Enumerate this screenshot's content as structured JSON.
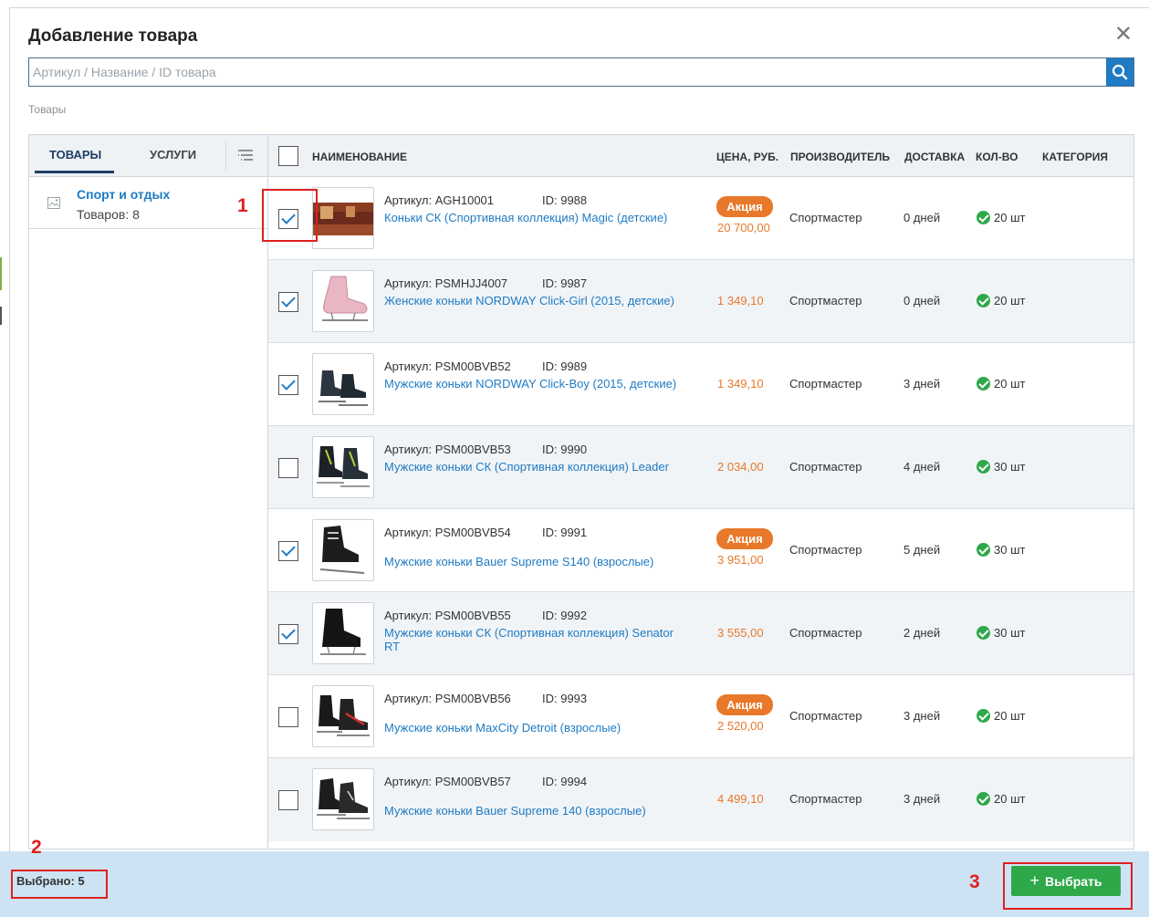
{
  "dialog": {
    "title": "Добавление товара",
    "close_glyph": "✕"
  },
  "search": {
    "placeholder": "Артикул / Название / ID товара",
    "value": ""
  },
  "breadcrumb": "Товары",
  "sidebar": {
    "tabs": [
      {
        "label": "ТОВАРЫ",
        "active": true
      },
      {
        "label": "УСЛУГИ",
        "active": false
      }
    ],
    "categories": [
      {
        "name": "Спорт и отдых",
        "count": "Товаров: 8"
      }
    ]
  },
  "table": {
    "headers": {
      "name": "НАИМЕНОВАНИЕ",
      "price": "ЦЕНА, РУБ.",
      "maker": "ПРОИЗВОДИТЕЛЬ",
      "delivery": "ДОСТАВКА",
      "qty": "КОЛ-ВО",
      "category": "КАТЕГОРИЯ"
    },
    "rows": [
      {
        "checked": true,
        "article": "Артикул: AGH10001",
        "id": "ID: 9988",
        "name": "Коньки СК (Спортивная коллекция) Magic (детские)",
        "promo": "Акция",
        "price": "20 700,00",
        "maker": "Спортмастер",
        "delivery": "0 дней",
        "qty": "20 шт"
      },
      {
        "checked": true,
        "article": "Артикул: PSMHJJ4007",
        "id": "ID: 9987",
        "name": "Женские коньки NORDWAY Click-Girl (2015, детские)",
        "promo": "",
        "price": "1 349,10",
        "maker": "Спортмастер",
        "delivery": "0 дней",
        "qty": "20 шт"
      },
      {
        "checked": true,
        "article": "Артикул: PSM00BVB52",
        "id": "ID: 9989",
        "name": "Мужские коньки NORDWAY Click-Boy (2015, детские)",
        "promo": "",
        "price": "1 349,10",
        "maker": "Спортмастер",
        "delivery": "3 дней",
        "qty": "20 шт"
      },
      {
        "checked": false,
        "article": "Артикул: PSM00BVB53",
        "id": "ID: 9990",
        "name": "Мужские коньки СК (Спортивная коллекция) Leader",
        "promo": "",
        "price": "2 034,00",
        "maker": "Спортмастер",
        "delivery": "4 дней",
        "qty": "30 шт"
      },
      {
        "checked": true,
        "article": "Артикул: PSM00BVB54",
        "id": "ID: 9991",
        "name": "Мужские коньки Bauer Supreme S140 (взрослые)",
        "promo": "Акция",
        "price": "3 951,00",
        "maker": "Спортмастер",
        "delivery": "5 дней",
        "qty": "30 шт"
      },
      {
        "checked": true,
        "article": "Артикул: PSM00BVB55",
        "id": "ID: 9992",
        "name": "Мужские коньки СК (Спортивная коллекция) Senator RT",
        "promo": "",
        "price": "3 555,00",
        "maker": "Спортмастер",
        "delivery": "2 дней",
        "qty": "30 шт"
      },
      {
        "checked": false,
        "article": "Артикул: PSM00BVB56",
        "id": "ID: 9993",
        "name": "Мужские коньки MaxCity Detroit (взрослые)",
        "promo": "Акция",
        "price": "2 520,00",
        "maker": "Спортмастер",
        "delivery": "3 дней",
        "qty": "20 шт"
      },
      {
        "checked": false,
        "article": "Артикул: PSM00BVB57",
        "id": "ID: 9994",
        "name": "Мужские коньки Bauer Supreme 140 (взрослые)",
        "promo": "",
        "price": "4 499,10",
        "maker": "Спортмастер",
        "delivery": "3 дней",
        "qty": "20 шт"
      }
    ]
  },
  "footer": {
    "selected": "Выбрано: 5",
    "choose_label": "Выбрать",
    "choose_glyph": "+"
  },
  "annotations": [
    "1",
    "2",
    "3"
  ],
  "colors": {
    "accent": "#1e7bc4",
    "promo": "#e8782a",
    "success": "#2fa84a",
    "footer": "#cde3f4",
    "annotation": "#e02020"
  }
}
